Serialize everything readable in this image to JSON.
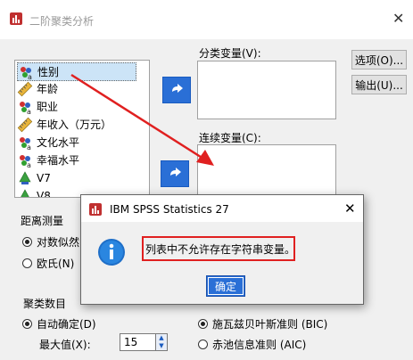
{
  "window": {
    "title": "二阶聚类分析"
  },
  "variables": [
    {
      "label": "性别",
      "icon": "nominal-icon",
      "selected": true
    },
    {
      "label": "年龄",
      "icon": "scale-icon"
    },
    {
      "label": "职业",
      "icon": "nominal-icon"
    },
    {
      "label": "年收入（万元）",
      "icon": "scale-icon"
    },
    {
      "label": "文化水平",
      "icon": "nominal-icon"
    },
    {
      "label": "幸福水平",
      "icon": "nominal-icon"
    },
    {
      "label": "V7",
      "icon": "ordinal-icon"
    },
    {
      "label": "V8",
      "icon": "ordinal-icon"
    }
  ],
  "categorical": {
    "label": "分类变量(V):"
  },
  "continuous": {
    "label": "连续变量(C):"
  },
  "buttons": {
    "options": "选项(O)...",
    "output": "输出(U)..."
  },
  "distance": {
    "label": "距离测量",
    "options": [
      {
        "label": "对数似然",
        "selected": true
      },
      {
        "label": "欧氏(N)",
        "selected": false
      }
    ]
  },
  "clusters": {
    "label": "聚类数目",
    "auto": "自动确定(D)",
    "max_label": "最大值(X):",
    "max_value": "15"
  },
  "criterion": {
    "bic": "施瓦兹贝叶斯准则 (BIC)",
    "aic": "赤池信息准则 (AIC)"
  },
  "dialog": {
    "title": "IBM SPSS Statistics 27",
    "message": "列表中不允许存在字符串变量。",
    "ok": "确定"
  },
  "colors": {
    "accent": "#2a6fd6",
    "highlight": "#e02020"
  }
}
